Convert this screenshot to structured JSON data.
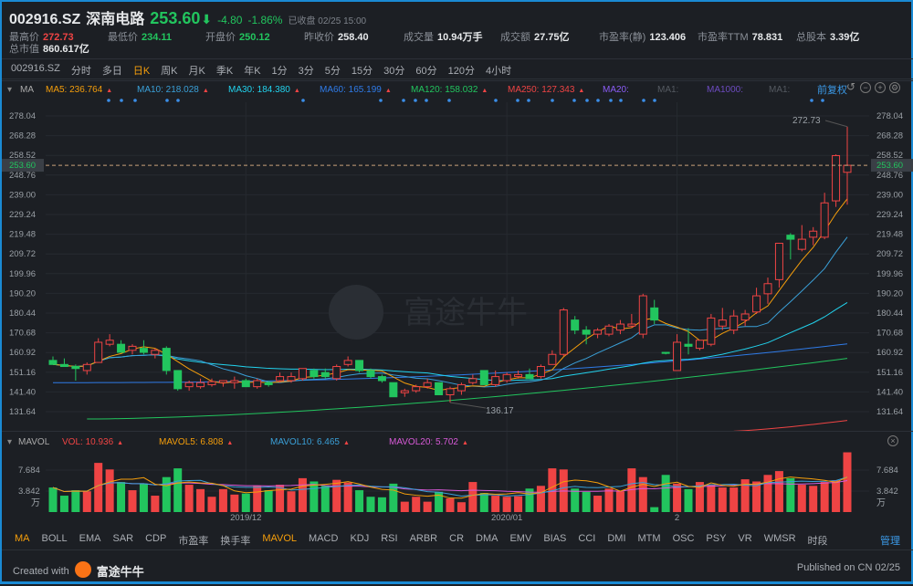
{
  "header": {
    "code": "002916.SZ",
    "name": "深南电路",
    "price": "253.60",
    "arrow": "⬇",
    "change": "-4.80",
    "change_pct": "-1.86%",
    "status": "已收盘 02/25 15:00"
  },
  "stats": [
    {
      "label": "最高价",
      "value": "272.73",
      "color": "#ef4444"
    },
    {
      "label": "最低价",
      "value": "234.11",
      "color": "#22c55e"
    },
    {
      "label": "开盘价",
      "value": "250.12",
      "color": "#22c55e"
    },
    {
      "label": "昨收价",
      "value": "258.40",
      "color": "#e6e8ea"
    },
    {
      "label": "成交量",
      "value": "10.94万手",
      "color": "#e6e8ea"
    },
    {
      "label": "成交额",
      "value": "27.75亿",
      "color": "#e6e8ea"
    },
    {
      "label": "市盈率(静)",
      "value": "123.406",
      "color": "#e6e8ea"
    },
    {
      "label": "市盈率TTM",
      "value": "78.831",
      "color": "#e6e8ea"
    },
    {
      "label": "总股本",
      "value": "3.39亿",
      "color": "#e6e8ea"
    },
    {
      "label": "总市值",
      "value": "860.617亿",
      "color": "#e6e8ea"
    }
  ],
  "tabs": [
    "002916.SZ",
    "分时",
    "多日",
    "日K",
    "周K",
    "月K",
    "季K",
    "年K",
    "1分",
    "3分",
    "5分",
    "15分",
    "30分",
    "60分",
    "120分",
    "4小时"
  ],
  "active_tab": "日K",
  "ma_legend": {
    "title": "MA",
    "items": [
      {
        "text": "MA5: 236.764",
        "color": "#f59e0b"
      },
      {
        "text": "MA10: 218.028",
        "color": "#3aa0d8"
      },
      {
        "text": "MA30: 184.380",
        "color": "#22d3ee"
      },
      {
        "text": "MA60: 165.199",
        "color": "#2f7be8"
      },
      {
        "text": "MA120: 158.032",
        "color": "#22c55e"
      },
      {
        "text": "MA250: 127.343",
        "color": "#ef4444"
      },
      {
        "text": "MA20:",
        "color": "#8b5cf6"
      },
      {
        "text": "MA1:",
        "color": "#555a61"
      },
      {
        "text": "MA1000:",
        "color": "#6d4bc0"
      },
      {
        "text": "MA1:",
        "color": "#555a61"
      }
    ],
    "adjust": "前复权"
  },
  "vol_legend": {
    "title": "MAVOL",
    "items": [
      {
        "text": "VOL: 10.936",
        "color": "#ef4444"
      },
      {
        "text": "MAVOL5: 6.808",
        "color": "#f59e0b"
      },
      {
        "text": "MAVOL10: 6.465",
        "color": "#3aa0d8"
      },
      {
        "text": "MAVOL20: 5.702",
        "color": "#d85ad8"
      }
    ]
  },
  "indicators": [
    "MA",
    "BOLL",
    "EMA",
    "SAR",
    "CDP",
    "市盈率",
    "换手率",
    "MAVOL",
    "MACD",
    "KDJ",
    "RSI",
    "ARBR",
    "CR",
    "DMA",
    "EMV",
    "BIAS",
    "CCI",
    "DMI",
    "MTM",
    "OSC",
    "PSY",
    "VR",
    "WMSR",
    "时段"
  ],
  "active_indicators": [
    "MA",
    "MAVOL"
  ],
  "manage": "管理",
  "footer": {
    "created": "Created with",
    "brand": "富途牛牛",
    "published": "Published on CN 02/25"
  },
  "watermark": "富途牛牛",
  "chart_data": {
    "type": "candlestick",
    "yticks": [
      "278.04",
      "268.28",
      "258.52",
      "248.76",
      "239.00",
      "229.24",
      "219.48",
      "209.72",
      "199.96",
      "190.20",
      "180.44",
      "170.68",
      "160.92",
      "151.16",
      "141.40",
      "131.64"
    ],
    "ylim": [
      131.64,
      278.04
    ],
    "last_price": "253.60",
    "high_label": "272.73",
    "low_label": "136.17",
    "x_labels": [
      {
        "text": "2019/12",
        "index": 17
      },
      {
        "text": "2020/01",
        "index": 40
      },
      {
        "text": "2",
        "index": 55
      }
    ],
    "ohlc": [
      [
        157,
        159,
        155,
        155
      ],
      [
        155,
        158,
        154,
        154
      ],
      [
        154,
        155,
        147,
        153
      ],
      [
        152,
        156,
        150,
        155
      ],
      [
        156,
        168,
        156,
        166
      ],
      [
        165,
        170,
        164,
        167
      ],
      [
        165,
        167,
        161,
        161
      ],
      [
        162,
        165,
        160,
        164
      ],
      [
        163,
        167,
        160,
        161
      ],
      [
        160,
        163,
        158,
        162
      ],
      [
        163,
        164,
        150,
        152
      ],
      [
        152,
        152,
        142,
        143
      ],
      [
        144,
        147,
        142,
        146
      ],
      [
        144,
        148,
        143,
        146
      ],
      [
        145,
        148,
        144,
        146.5
      ],
      [
        146,
        147,
        144,
        147
      ],
      [
        146,
        149,
        143,
        147
      ],
      [
        147,
        148,
        144,
        144
      ],
      [
        144,
        148,
        143,
        147
      ],
      [
        146,
        147,
        144,
        145
      ],
      [
        147,
        151,
        146,
        149
      ],
      [
        147,
        151,
        146,
        149
      ],
      [
        148,
        153,
        147,
        153
      ],
      [
        152,
        153,
        148,
        149
      ],
      [
        151,
        153,
        148,
        149
      ],
      [
        148,
        155,
        147,
        154
      ],
      [
        155,
        159,
        154,
        157
      ],
      [
        157,
        157,
        151,
        152
      ],
      [
        152,
        153,
        148,
        149
      ],
      [
        149,
        150,
        146,
        147
      ],
      [
        146,
        146,
        139,
        139
      ],
      [
        141,
        143,
        139,
        142
      ],
      [
        142,
        145,
        141,
        144
      ],
      [
        144,
        148,
        143,
        146
      ],
      [
        146,
        146,
        140,
        140
      ],
      [
        140,
        144,
        136.17,
        143
      ],
      [
        142,
        146,
        140,
        145
      ],
      [
        146,
        150,
        145,
        148
      ],
      [
        152,
        152,
        145,
        145
      ],
      [
        145,
        152,
        144,
        149
      ],
      [
        147,
        151,
        146,
        150
      ],
      [
        149,
        152,
        148,
        150
      ],
      [
        150,
        153,
        148,
        148
      ],
      [
        149,
        155,
        148,
        154
      ],
      [
        155,
        162,
        155,
        160
      ],
      [
        160,
        183,
        159,
        182
      ],
      [
        177,
        179,
        170,
        172
      ],
      [
        172,
        174,
        165,
        170
      ],
      [
        170,
        173,
        168,
        172
      ],
      [
        170,
        175,
        169,
        174
      ],
      [
        172,
        177,
        170,
        175
      ],
      [
        174,
        180,
        173,
        175
      ],
      [
        170,
        190,
        168,
        189
      ],
      [
        183,
        187,
        175,
        177
      ],
      [
        161,
        161,
        160,
        160.5
      ],
      [
        152,
        170,
        152,
        166
      ],
      [
        165,
        173,
        160,
        164
      ],
      [
        163,
        167,
        162,
        167
      ],
      [
        165,
        180,
        164,
        178
      ],
      [
        174,
        183,
        172,
        177
      ],
      [
        172,
        182,
        170,
        179
      ],
      [
        177,
        182,
        174,
        180
      ],
      [
        181,
        193,
        180,
        189
      ],
      [
        190,
        198,
        185,
        195
      ],
      [
        197,
        215,
        193,
        215
      ],
      [
        219,
        220,
        207,
        217
      ],
      [
        212,
        224,
        211,
        217
      ],
      [
        218,
        223,
        214,
        221
      ],
      [
        218,
        240,
        217,
        235
      ],
      [
        236,
        259,
        233,
        258.4
      ],
      [
        250.12,
        272.73,
        234.11,
        253.6
      ]
    ],
    "ma60_range": [
      146,
      165.2
    ],
    "ma120_range": [
      128,
      158.0
    ],
    "ma250_range": [
      122,
      127.3
    ],
    "volume_yticks": [
      "7.684",
      "3.842"
    ],
    "volume_unit": "万",
    "volume": [
      4.5,
      3,
      4,
      3.8,
      9,
      7.8,
      5.5,
      4,
      5.2,
      3,
      6.4,
      8,
      5,
      4.2,
      2.8,
      4.2,
      3.2,
      3.4,
      4.8,
      4,
      5,
      3.8,
      6.2,
      5.6,
      4.8,
      5.9,
      5.4,
      4,
      2.8,
      2.7,
      5.2,
      1.9,
      2.8,
      1.9,
      3.7,
      2.5,
      1.8,
      5.5,
      3.5,
      3,
      2.8,
      2.9,
      4.3,
      4.8,
      8,
      7.8,
      4.3,
      3.7,
      3,
      4.3,
      3.8,
      8,
      6.4,
      0.9,
      6.8,
      5.2,
      4.2,
      5.5,
      5,
      4.5,
      4.5,
      6,
      5.6,
      6.8,
      7.5,
      6.2,
      5,
      4.8,
      5.5,
      5.8,
      10.936
    ]
  }
}
